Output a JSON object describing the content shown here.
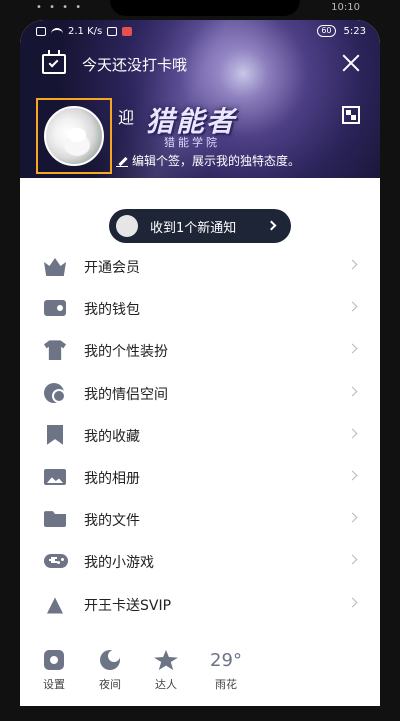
{
  "outer_status": {
    "time": "10:10",
    "signal": "• • • •"
  },
  "inner_status": {
    "net_speed": "2.1 K/s",
    "battery": "60",
    "time": "5:23"
  },
  "header": {
    "checkin_text": "今天还没打卡哦",
    "nickname": "迎",
    "title_art": "猎能者",
    "title_sub": "猎能学院",
    "signature": "编辑个签，展示我的独特态度。"
  },
  "notification": {
    "text": "收到1个新通知"
  },
  "menu": {
    "items": [
      {
        "label": "开通会员",
        "icon": "vip-crown-icon"
      },
      {
        "label": "我的钱包",
        "icon": "wallet-icon"
      },
      {
        "label": "我的个性装扮",
        "icon": "shirt-icon"
      },
      {
        "label": "我的情侣空间",
        "icon": "couple-icon"
      },
      {
        "label": "我的收藏",
        "icon": "bookmark-icon"
      },
      {
        "label": "我的相册",
        "icon": "photo-icon"
      },
      {
        "label": "我的文件",
        "icon": "folder-icon"
      },
      {
        "label": "我的小游戏",
        "icon": "gamepad-icon"
      },
      {
        "label": "开王卡送SVIP",
        "icon": "signal-tower-icon"
      }
    ]
  },
  "bottom": {
    "settings": "设置",
    "night": "夜间",
    "expert": "达人",
    "temperature": "29°",
    "weather": "雨花"
  },
  "colors": {
    "icon": "#6c7486",
    "accent_frame": "#f6a623",
    "pill_bg": "#1d2536"
  }
}
